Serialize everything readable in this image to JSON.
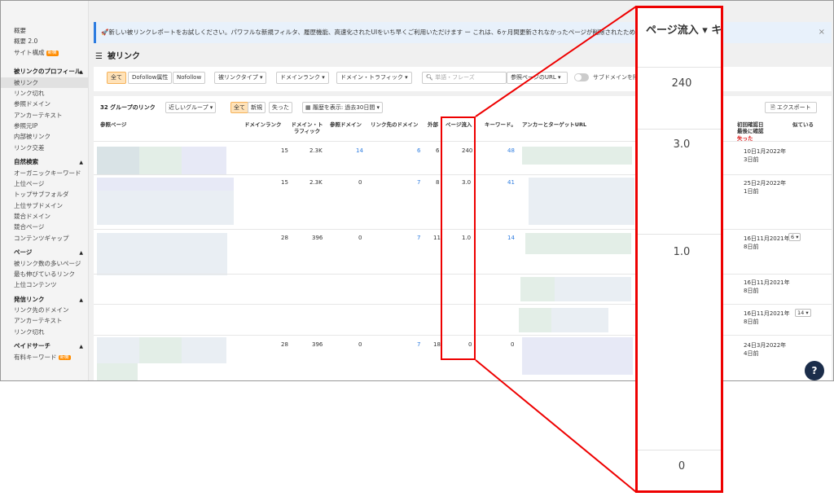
{
  "sidebar": {
    "items_top": [
      "概要",
      "概要 2.0",
      "サイト構成"
    ],
    "new_badge": "新機",
    "sections": [
      {
        "title": "被リンクのプロフィール",
        "items": [
          "被リンク",
          "リンク切れ",
          "参照ドメイン",
          "アンカーテキスト",
          "参照元IP",
          "内部被リンク",
          "リンク交差"
        ]
      },
      {
        "title": "自然検索",
        "items": [
          "オーガニックキーワード",
          "上位ページ",
          "トップサブフォルダ",
          "上位サブドメイン",
          "競合ドメイン",
          "競合ページ",
          "コンテンツギャップ"
        ]
      },
      {
        "title": "ページ",
        "items": [
          "被リンク数の多いページ",
          "最も伸びているリンク",
          "上位コンテンツ"
        ]
      },
      {
        "title": "発信リンク",
        "items": [
          "リンク先のドメイン",
          "アンカーテキスト",
          "リンク切れ"
        ]
      },
      {
        "title": "ペイドサーチ",
        "items": [
          "有料キーワード"
        ]
      }
    ]
  },
  "banner": {
    "text": "🚀新しい被リンクレポートをお試しください。パワフルな新規フィルタ、履歴機能、高速化されたUIをいち早くご利用いただけます ー これは、6ヶ月間更新されなかったページが削除されたためです。",
    "close": "×"
  },
  "page_title": "被リンク",
  "filters": {
    "all": "全て",
    "dofollow": "Dofollow属性",
    "nofollow": "Nofollow",
    "link_type": "被リンクタイプ ▾",
    "domain_rank": "ドメインランク ▾",
    "domain_traffic": "ドメイン・トラフィック ▾",
    "search_placeholder": "単語・フレーズ",
    "ref_page_url": "参照ページのURL ▾",
    "subdomain_label": "サブドメインを除外"
  },
  "groupbar": {
    "count_label": "32 グループのリンク",
    "group_select": "近しいグループ ▾",
    "all": "全て",
    "new": "新規",
    "lost": "失った",
    "history": "履歴を表示: 過去30日間 ▾",
    "export": "エクスポート"
  },
  "columns": {
    "ref_page": "参照ページ",
    "domain_rank": "ドメインランク",
    "domain_traffic": "ドメイン・トラフィック",
    "ref_domains": "参照ドメイン",
    "linked_domains": "リンク先のドメイン",
    "external": "外部",
    "page_traffic": "ページ流入",
    "keywords": "キーワード。",
    "anchor_target": "アンカーとターゲットURL",
    "first_seen": "初回確認日 最後に確認 失った",
    "similar": "似ている"
  },
  "rows": [
    {
      "dr": "15",
      "traffic": "2.3K",
      "ref": "14",
      "linked": "6",
      "ext": "6",
      "page_traffic": "240",
      "kw": "48",
      "dates": [
        "10日1月2022年",
        "3日前"
      ],
      "similar": ""
    },
    {
      "dr": "15",
      "traffic": "2.3K",
      "ref": "0",
      "linked": "7",
      "ext": "8",
      "page_traffic": "3.0",
      "kw": "41",
      "dates": [
        "25日2月2022年",
        "1日前"
      ],
      "similar": ""
    },
    {
      "dr": "28",
      "traffic": "396",
      "ref": "0",
      "linked": "7",
      "ext": "11",
      "page_traffic": "1.0",
      "kw": "14",
      "dates": [
        "16日11月2021年",
        "8日前"
      ],
      "similar": "6 ▾"
    },
    {
      "dr": "",
      "traffic": "",
      "ref": "",
      "linked": "",
      "ext": "",
      "page_traffic": "",
      "kw": "",
      "dates": [
        "16日11月2021年",
        "8日前"
      ],
      "similar": ""
    },
    {
      "dr": "",
      "traffic": "",
      "ref": "",
      "linked": "",
      "ext": "",
      "page_traffic": "",
      "kw": "",
      "dates": [
        "16日11月2021年",
        "8日前"
      ],
      "similar": "14 ▾"
    },
    {
      "dr": "28",
      "traffic": "396",
      "ref": "0",
      "linked": "7",
      "ext": "18",
      "page_traffic": "0",
      "kw": "0",
      "dates": [
        "24日3月2022年",
        "4日前"
      ],
      "similar": ""
    }
  ],
  "zoom": {
    "header": "ページ流入 ▾ キ",
    "values": [
      "240",
      "3.0",
      "1.0",
      "0"
    ]
  },
  "help": "?"
}
